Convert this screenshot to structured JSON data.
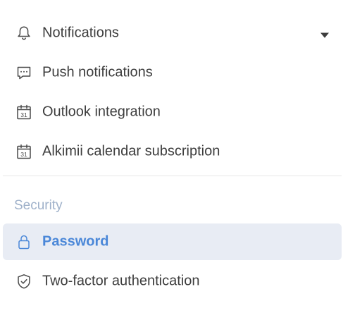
{
  "settings_menu": {
    "notifications_group": {
      "items": [
        {
          "label": "Notifications",
          "icon": "bell-icon",
          "expandable": true,
          "expand_icon": "caret-down-icon"
        },
        {
          "label": "Push notifications",
          "icon": "chat-bubble-icon"
        },
        {
          "label": "Outlook integration",
          "icon": "calendar-icon",
          "icon_text": "31"
        },
        {
          "label": "Alkimii calendar subscription",
          "icon": "calendar-icon",
          "icon_text": "31"
        }
      ]
    },
    "security_group": {
      "heading": "Security",
      "items": [
        {
          "label": "Password",
          "icon": "lock-icon",
          "active": true
        },
        {
          "label": "Two-factor authentication",
          "icon": "shield-check-icon"
        }
      ]
    }
  },
  "colors": {
    "text": "#3d3d3d",
    "icon": "#4a4a4a",
    "active_background": "#e8ecf4",
    "active_text": "#4a87d8",
    "section_heading": "#9fb1ca",
    "divider": "#e6e6e6"
  }
}
